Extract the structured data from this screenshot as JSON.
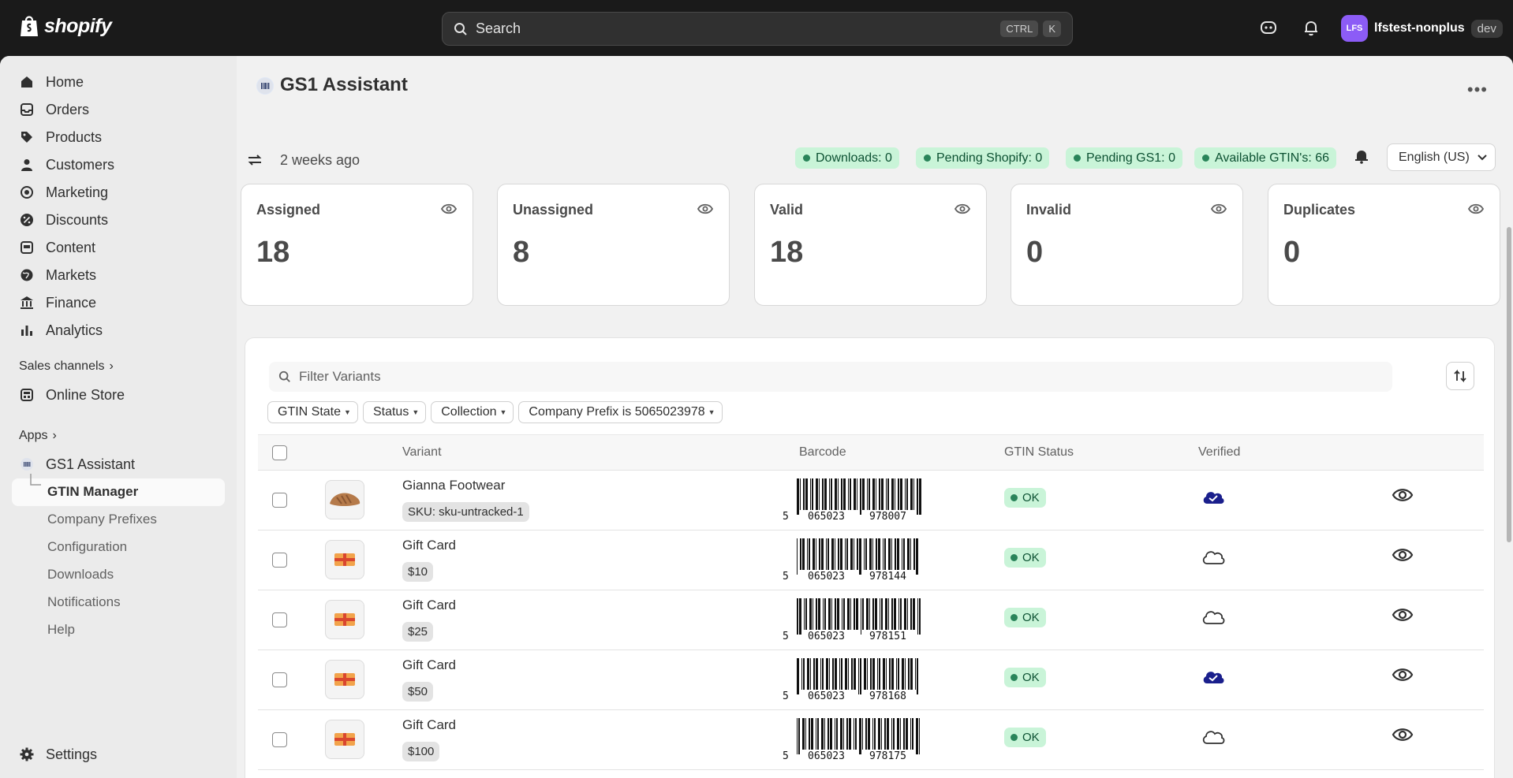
{
  "topbar": {
    "logo_text": "shopify",
    "search_placeholder": "Search",
    "search_keys": [
      "CTRL",
      "K"
    ],
    "user_initials": "LFS",
    "user_name": "lfstest-nonplus",
    "env_badge": "dev"
  },
  "sidebar": {
    "items": [
      {
        "label": "Home",
        "icon": "home-icon"
      },
      {
        "label": "Orders",
        "icon": "inbox-icon"
      },
      {
        "label": "Products",
        "icon": "tag-icon"
      },
      {
        "label": "Customers",
        "icon": "person-icon"
      },
      {
        "label": "Marketing",
        "icon": "target-icon"
      },
      {
        "label": "Discounts",
        "icon": "discount-icon"
      },
      {
        "label": "Content",
        "icon": "image-icon"
      },
      {
        "label": "Markets",
        "icon": "globe-icon"
      },
      {
        "label": "Finance",
        "icon": "bank-icon"
      },
      {
        "label": "Analytics",
        "icon": "chart-icon"
      }
    ],
    "sales_channels_label": "Sales channels",
    "online_store_label": "Online Store",
    "apps_label": "Apps",
    "app_name": "GS1 Assistant",
    "app_sub_items": [
      "GTIN Manager",
      "Company Prefixes",
      "Configuration",
      "Downloads",
      "Notifications",
      "Help"
    ],
    "settings_label": "Settings"
  },
  "page": {
    "title": "GS1 Assistant",
    "sync_text": "2 weeks ago",
    "pills": [
      "Downloads: 0",
      "Pending Shopify: 0",
      "Pending GS1: 0",
      "Available GTIN's: 66"
    ],
    "language": "English (US)",
    "accent_green": "#c9f4d8"
  },
  "stats": [
    {
      "label": "Assigned",
      "value": "18"
    },
    {
      "label": "Unassigned",
      "value": "8"
    },
    {
      "label": "Valid",
      "value": "18"
    },
    {
      "label": "Invalid",
      "value": "0"
    },
    {
      "label": "Duplicates",
      "value": "0"
    }
  ],
  "table": {
    "filter_placeholder": "Filter Variants",
    "chips": [
      "GTIN State",
      "Status",
      "Collection",
      "Company Prefix is 5065023978"
    ],
    "headers": {
      "variant": "Variant",
      "barcode": "Barcode",
      "gtin_status": "GTIN Status",
      "verified": "Verified"
    },
    "rows": [
      {
        "name": "Gianna Footwear",
        "tag": "SKU: sku-untracked-1",
        "thumb": "sandal",
        "bc_first": "5",
        "bc_left": "065023",
        "bc_right": "978007",
        "status": "OK",
        "verified": true
      },
      {
        "name": "Gift Card",
        "tag": "$10",
        "thumb": "gift",
        "bc_first": "5",
        "bc_left": "065023",
        "bc_right": "978144",
        "status": "OK",
        "verified": false
      },
      {
        "name": "Gift Card",
        "tag": "$25",
        "thumb": "gift",
        "bc_first": "5",
        "bc_left": "065023",
        "bc_right": "978151",
        "status": "OK",
        "verified": false
      },
      {
        "name": "Gift Card",
        "tag": "$50",
        "thumb": "gift",
        "bc_first": "5",
        "bc_left": "065023",
        "bc_right": "978168",
        "status": "OK",
        "verified": true
      },
      {
        "name": "Gift Card",
        "tag": "$100",
        "thumb": "gift",
        "bc_first": "5",
        "bc_left": "065023",
        "bc_right": "978175",
        "status": "OK",
        "verified": false
      }
    ]
  }
}
